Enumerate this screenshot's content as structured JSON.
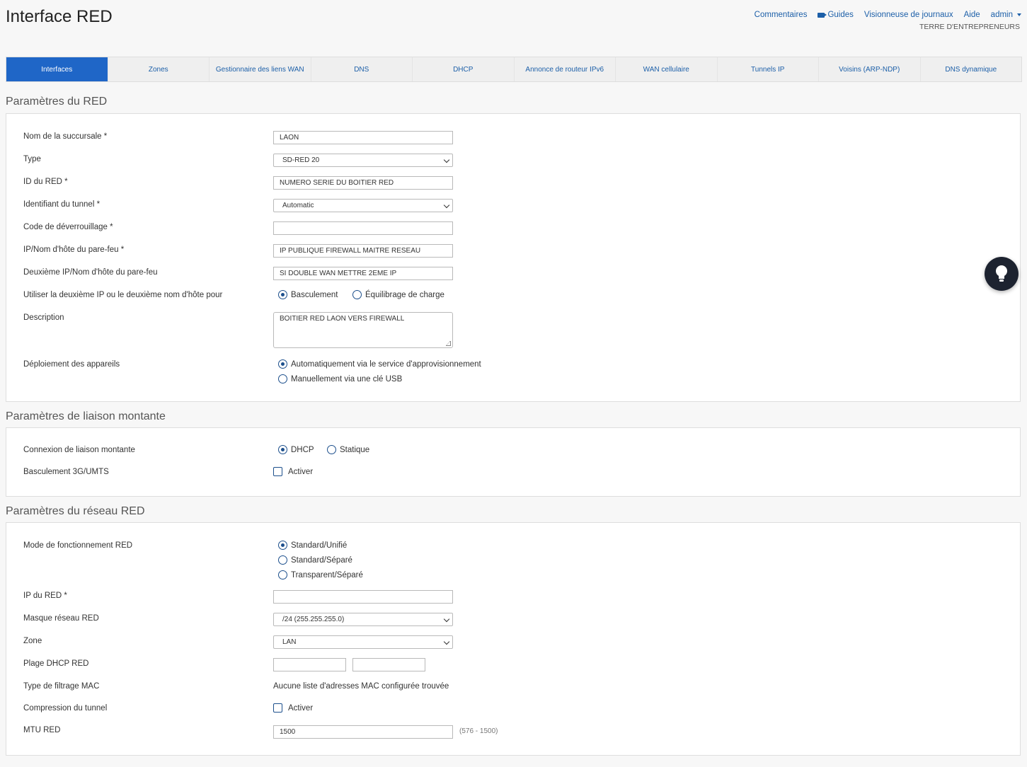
{
  "header": {
    "title": "Interface RED",
    "nav": {
      "comments": "Commentaires",
      "guides": "Guides",
      "log_viewer": "Visionneuse de journaux",
      "help": "Aide",
      "user": "admin"
    },
    "org": "TERRE D'ENTREPRENEURS"
  },
  "tabs": [
    {
      "label": "Interfaces",
      "active": true
    },
    {
      "label": "Zones"
    },
    {
      "label": "Gestionnaire des liens WAN"
    },
    {
      "label": "DNS"
    },
    {
      "label": "DHCP"
    },
    {
      "label": "Annonce de routeur IPv6"
    },
    {
      "label": "WAN cellulaire"
    },
    {
      "label": "Tunnels IP"
    },
    {
      "label": "Voisins (ARP-NDP)"
    },
    {
      "label": "DNS dynamique"
    }
  ],
  "red_settings": {
    "title": "Paramètres du RED",
    "branch_name": {
      "label": "Nom de la succursale *",
      "value": "LAON"
    },
    "type": {
      "label": "Type",
      "value": "SD-RED 20"
    },
    "red_id": {
      "label": "ID du RED *",
      "value": "NUMERO SERIE DU BOITIER RED"
    },
    "tunnel_id": {
      "label": "Identifiant du tunnel *",
      "value": "Automatic"
    },
    "unlock_code": {
      "label": "Code de déverrouillage *",
      "value": ""
    },
    "firewall_host": {
      "label": "IP/Nom d'hôte du pare-feu *",
      "value": "IP PUBLIQUE FIREWALL MAITRE RESEAU"
    },
    "second_firewall_host": {
      "label": "Deuxième IP/Nom d'hôte du pare-feu",
      "value": "SI DOUBLE WAN METTRE 2EME IP"
    },
    "second_use": {
      "label": "Utiliser la deuxième IP ou le deuxième nom d'hôte pour",
      "options": [
        "Basculement",
        "Équilibrage de charge"
      ],
      "selected": "Basculement"
    },
    "description": {
      "label": "Description",
      "value": "BOITIER RED LAON VERS FIREWALL"
    },
    "deployment": {
      "label": "Déploiement des appareils",
      "options": [
        "Automatiquement via le service d'approvisionnement",
        "Manuellement via une clé USB"
      ],
      "selected": "Automatiquement via le service d'approvisionnement"
    }
  },
  "uplink_settings": {
    "title": "Paramètres de liaison montante",
    "connection": {
      "label": "Connexion de liaison montante",
      "options": [
        "DHCP",
        "Statique"
      ],
      "selected": "DHCP"
    },
    "failover_3g": {
      "label": "Basculement 3G/UMTS",
      "checkbox_label": "Activer",
      "checked": false
    }
  },
  "network_settings": {
    "title": "Paramètres du réseau RED",
    "mode": {
      "label": "Mode de fonctionnement RED",
      "options": [
        "Standard/Unifié",
        "Standard/Séparé",
        "Transparent/Séparé"
      ],
      "selected": "Standard/Unifié"
    },
    "red_ip": {
      "label": "IP du RED *",
      "value": ""
    },
    "netmask": {
      "label": "Masque réseau RED",
      "value": "/24 (255.255.255.0)"
    },
    "zone": {
      "label": "Zone",
      "value": "LAN"
    },
    "dhcp_range": {
      "label": "Plage DHCP RED",
      "start": "",
      "end": ""
    },
    "mac_filter": {
      "label": "Type de filtrage MAC",
      "value": "Aucune liste d'adresses MAC configurée trouvée"
    },
    "compression": {
      "label": "Compression du tunnel",
      "checkbox_label": "Activer",
      "checked": false
    },
    "mtu": {
      "label": "MTU RED",
      "value": "1500",
      "hint": "(576 - 1500)"
    }
  },
  "icons": {
    "guides": "video-camera-icon",
    "user_menu": "caret-down-icon",
    "fab": "lightbulb-icon"
  },
  "colors": {
    "accent": "#1f66c7",
    "link": "#1c5fa8",
    "fab_bg": "#1d2330"
  }
}
